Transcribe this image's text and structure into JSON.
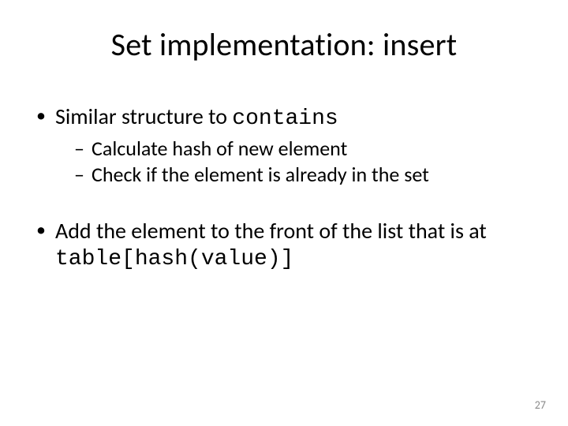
{
  "title": "Set implementation: insert",
  "bullets": [
    {
      "text_pre": "Similar structure to ",
      "code": "contains",
      "sub": [
        "Calculate hash of new element",
        "Check if the element is already in the set"
      ]
    },
    {
      "text_pre": "Add the element to the front of the list that is at ",
      "code": "table[hash(value)]",
      "sub": []
    }
  ],
  "page_number": "27"
}
